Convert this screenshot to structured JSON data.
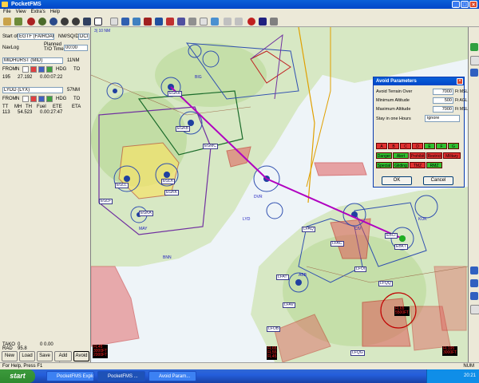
{
  "window": {
    "title": "PocketFMS",
    "min_glyph": "_",
    "max_glyph": "□",
    "close_glyph": "×"
  },
  "menu": {
    "items": [
      "File",
      "View",
      "Extra's",
      "Help"
    ]
  },
  "map": {
    "coord_label": "3| 10 NM",
    "airport_labels": [
      "EGKR",
      "EGKB",
      "EGLL",
      "EGLK",
      "EGLF",
      "EGKK",
      "EGMC",
      "EGKA",
      "EBCI",
      "EBKT",
      "LFAQ",
      "LFAT",
      "LFOI",
      "LFAC",
      "LFQQ",
      "LFAV",
      "LFQG",
      "LFOB"
    ],
    "vor_labels": [
      "BIG",
      "DVR",
      "LYD",
      "MAY",
      "BNN",
      "KOK",
      "CIV",
      "ABB"
    ],
    "alt_boxes": [
      {
        "text": "FL45\n3000FT\n2000FT"
      },
      {
        "text": "FL65\nFL55\nFL45"
      },
      {
        "text": "FL65\n5500FT"
      },
      {
        "text": "FL195\n3000FT"
      }
    ]
  },
  "left_panel": {
    "start_label": "Start of",
    "start_value": "EGTF (FAIROAKS)",
    "mission_label": "NM/SQ/DIS",
    "mission_value": "DCI",
    "nav_log": "NavLog",
    "planned_label": "Planned",
    "planned_value": "T/O Time",
    "time_value": "00:00",
    "wpt1": "MIDHURST (MID)",
    "wpt1_dist": "11NM",
    "r1a": "FROM",
    "r1b": "N",
    "r1c": "HDG",
    "r1d": "TO",
    "num1": "195",
    "num1b": "27.192",
    "num1c": "0.00:07:22",
    "wpt2": "LYDD (LYX)",
    "wpt2_dist": "57NM",
    "r2a": "FROM",
    "r2b": "N",
    "r2c": "HDG",
    "r2d": "TO",
    "num2": "113",
    "num2b": "54.523",
    "num2c": "0.00:27:47",
    "tt_headers": [
      "TT",
      "MH",
      "TH",
      "Fuel",
      "ETE",
      "ETA"
    ],
    "rad_label": "RAD",
    "rad_value": "95.8",
    "total_label": "TAKO",
    "total_value": "0",
    "total_right": "0  0.00",
    "buttons": [
      "New",
      "Load",
      "Save",
      "Add Leg",
      "Avoid"
    ]
  },
  "dialog": {
    "title": "Avoid Parameters",
    "close_glyph": "×",
    "rows": [
      {
        "label": "Avoid Terrain Over",
        "value": "7000",
        "unit": "Ft MSL"
      },
      {
        "label": "Minimum Altitude",
        "value": "500",
        "unit": "Ft AGL"
      },
      {
        "label": "Maximum Altitude",
        "value": "7000",
        "unit": "Ft MSL"
      }
    ],
    "stay_label": "Stay in one Hours",
    "stay_value": "ignore",
    "class_row1": [
      "A",
      "B",
      "C",
      "D",
      "E",
      "F",
      "G"
    ],
    "class_row2": [
      "Danger",
      "Alert",
      "Prohibit",
      "Restrict",
      "Military"
    ],
    "class_row3": [
      "Special",
      "Gliding",
      "TMZ",
      "RMZ"
    ],
    "ok": "OK",
    "cancel": "Cancel"
  },
  "status": {
    "left": "For Help, Press F1",
    "right": "NUM"
  },
  "taskbar": {
    "start": "start",
    "tasks": [
      "PocketFMS Explorer",
      "PocketFMS ...",
      "Avoid Param..."
    ],
    "clock": "20:21"
  }
}
